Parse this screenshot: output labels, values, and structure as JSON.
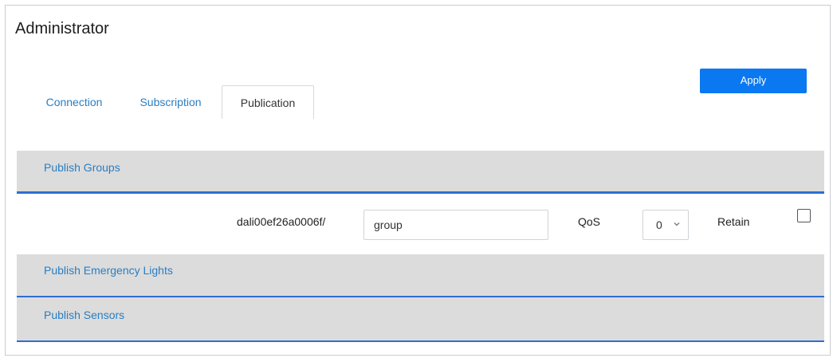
{
  "header": {
    "title": "Administrator",
    "apply_label": "Apply"
  },
  "tabs": [
    {
      "label": "Connection",
      "active": false
    },
    {
      "label": "Subscription",
      "active": false
    },
    {
      "label": "Publication",
      "active": true
    }
  ],
  "sections": {
    "groups": {
      "label": "Publish Groups",
      "expanded": true,
      "row": {
        "topic_prefix": "dali00ef26a0006f/",
        "topic_value": "group",
        "qos_label": "QoS",
        "qos_value": "0",
        "retain_label": "Retain",
        "retain_checked": false
      }
    },
    "emergency": {
      "label": "Publish Emergency Lights",
      "expanded": false
    },
    "sensors": {
      "label": "Publish Sensors",
      "expanded": false
    }
  },
  "colors": {
    "accent": "#2a7ec2",
    "button": "#0a78f0",
    "section_bg": "#dcdcdc",
    "divider": "#2c6fd1"
  },
  "icons": {
    "qos_dropdown": "chevron-down-icon"
  }
}
